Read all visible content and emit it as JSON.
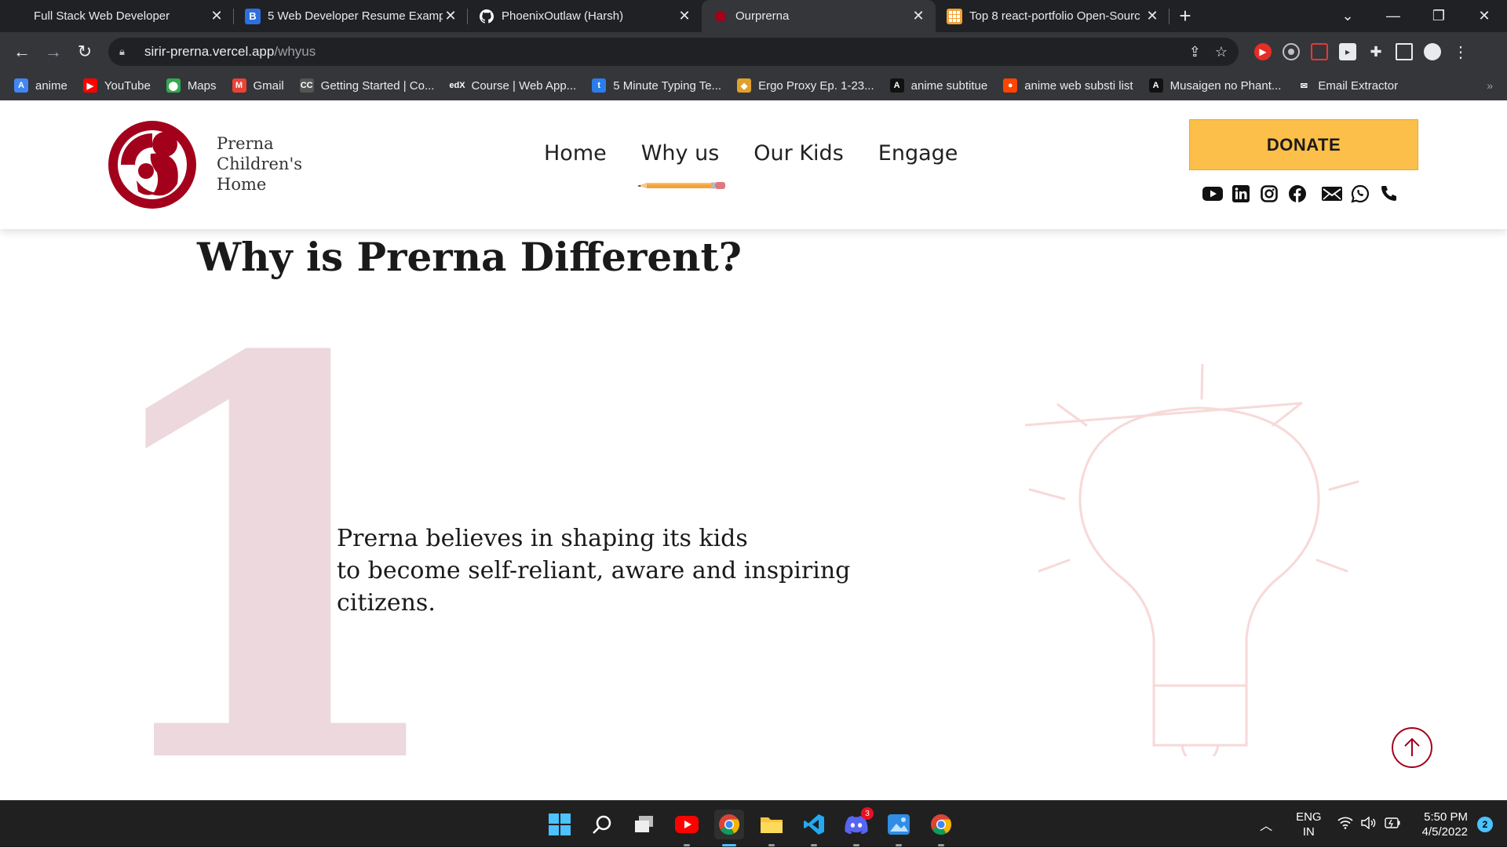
{
  "browser": {
    "tabs": [
      {
        "title": "Full Stack Web Developer",
        "icon": "none",
        "active": false
      },
      {
        "title": "5 Web Developer Resume Examp",
        "icon": "b-icon",
        "active": false
      },
      {
        "title": "PhoenixOutlaw (Harsh)",
        "icon": "github-icon",
        "active": false
      },
      {
        "title": "Ourprerna",
        "icon": "prerna-icon",
        "active": true
      },
      {
        "title": "Top 8 react-portfolio Open-Sourc",
        "icon": "grid-icon",
        "active": false
      }
    ],
    "new_tab_label": "+",
    "close_glyph": "✕",
    "window": {
      "minimize": "—",
      "restore": "❐",
      "close": "✕",
      "tab_search": "⌄"
    },
    "address": {
      "host": "sirir-prerna.vercel.app",
      "path": "/whyus"
    },
    "bookmarks": [
      {
        "label": "anime",
        "icon": "A",
        "color": "#4285f4"
      },
      {
        "label": "YouTube",
        "icon": "▶",
        "color": "#ff0000"
      },
      {
        "label": "Maps",
        "icon": "⬤",
        "color": "#34a853"
      },
      {
        "label": "Gmail",
        "icon": "M",
        "color": "#ea4335"
      },
      {
        "label": "Getting Started | Co...",
        "icon": "CC",
        "color": "#555555"
      },
      {
        "label": "Course | Web App...",
        "icon": "edX",
        "color": "#35363a"
      },
      {
        "label": "5 Minute Typing Te...",
        "icon": "t",
        "color": "#2b7de9"
      },
      {
        "label": "Ergo Proxy Ep. 1-23...",
        "icon": "◆",
        "color": "#e0a02a"
      },
      {
        "label": "anime subtitue",
        "icon": "A",
        "color": "#111111"
      },
      {
        "label": "anime web substi list",
        "icon": "●",
        "color": "#ff4500"
      },
      {
        "label": "Musaigen no Phant...",
        "icon": "A",
        "color": "#111111"
      },
      {
        "label": "Email Extractor",
        "icon": "✉",
        "color": "#35363a"
      }
    ],
    "bookmarks_more": "»"
  },
  "site": {
    "brand": {
      "line1": "Prerna",
      "line2": "Children's",
      "line3": "Home"
    },
    "nav": [
      {
        "label": "Home"
      },
      {
        "label": "Why us"
      },
      {
        "label": "Our Kids"
      },
      {
        "label": "Engage"
      }
    ],
    "active_nav": "Why us",
    "donate_label": "DONATE",
    "socials": [
      "youtube-icon",
      "linkedin-icon",
      "instagram-icon",
      "facebook-icon",
      "mail-icon",
      "whatsapp-icon",
      "phone-icon"
    ],
    "accent_color": "#a3001c",
    "donate_color": "#fcbf49"
  },
  "content": {
    "headline": "Why is Prerna Different?",
    "number": "1",
    "paragraph": {
      "line1": "Prerna believes in shaping its kids",
      "line2": "to become self-reliant, aware and inspiring",
      "line3": "citizens."
    }
  },
  "taskbar": {
    "apps": [
      "windows-start-icon",
      "search-icon",
      "task-view-icon",
      "youtube-icon",
      "chrome-icon",
      "file-explorer-icon",
      "vscode-icon",
      "discord-icon",
      "photos-icon",
      "chrome-icon"
    ],
    "discord_badge": "3",
    "language": {
      "line1": "ENG",
      "line2": "IN"
    },
    "time": "5:50 PM",
    "date": "4/5/2022",
    "notifications": "2"
  }
}
